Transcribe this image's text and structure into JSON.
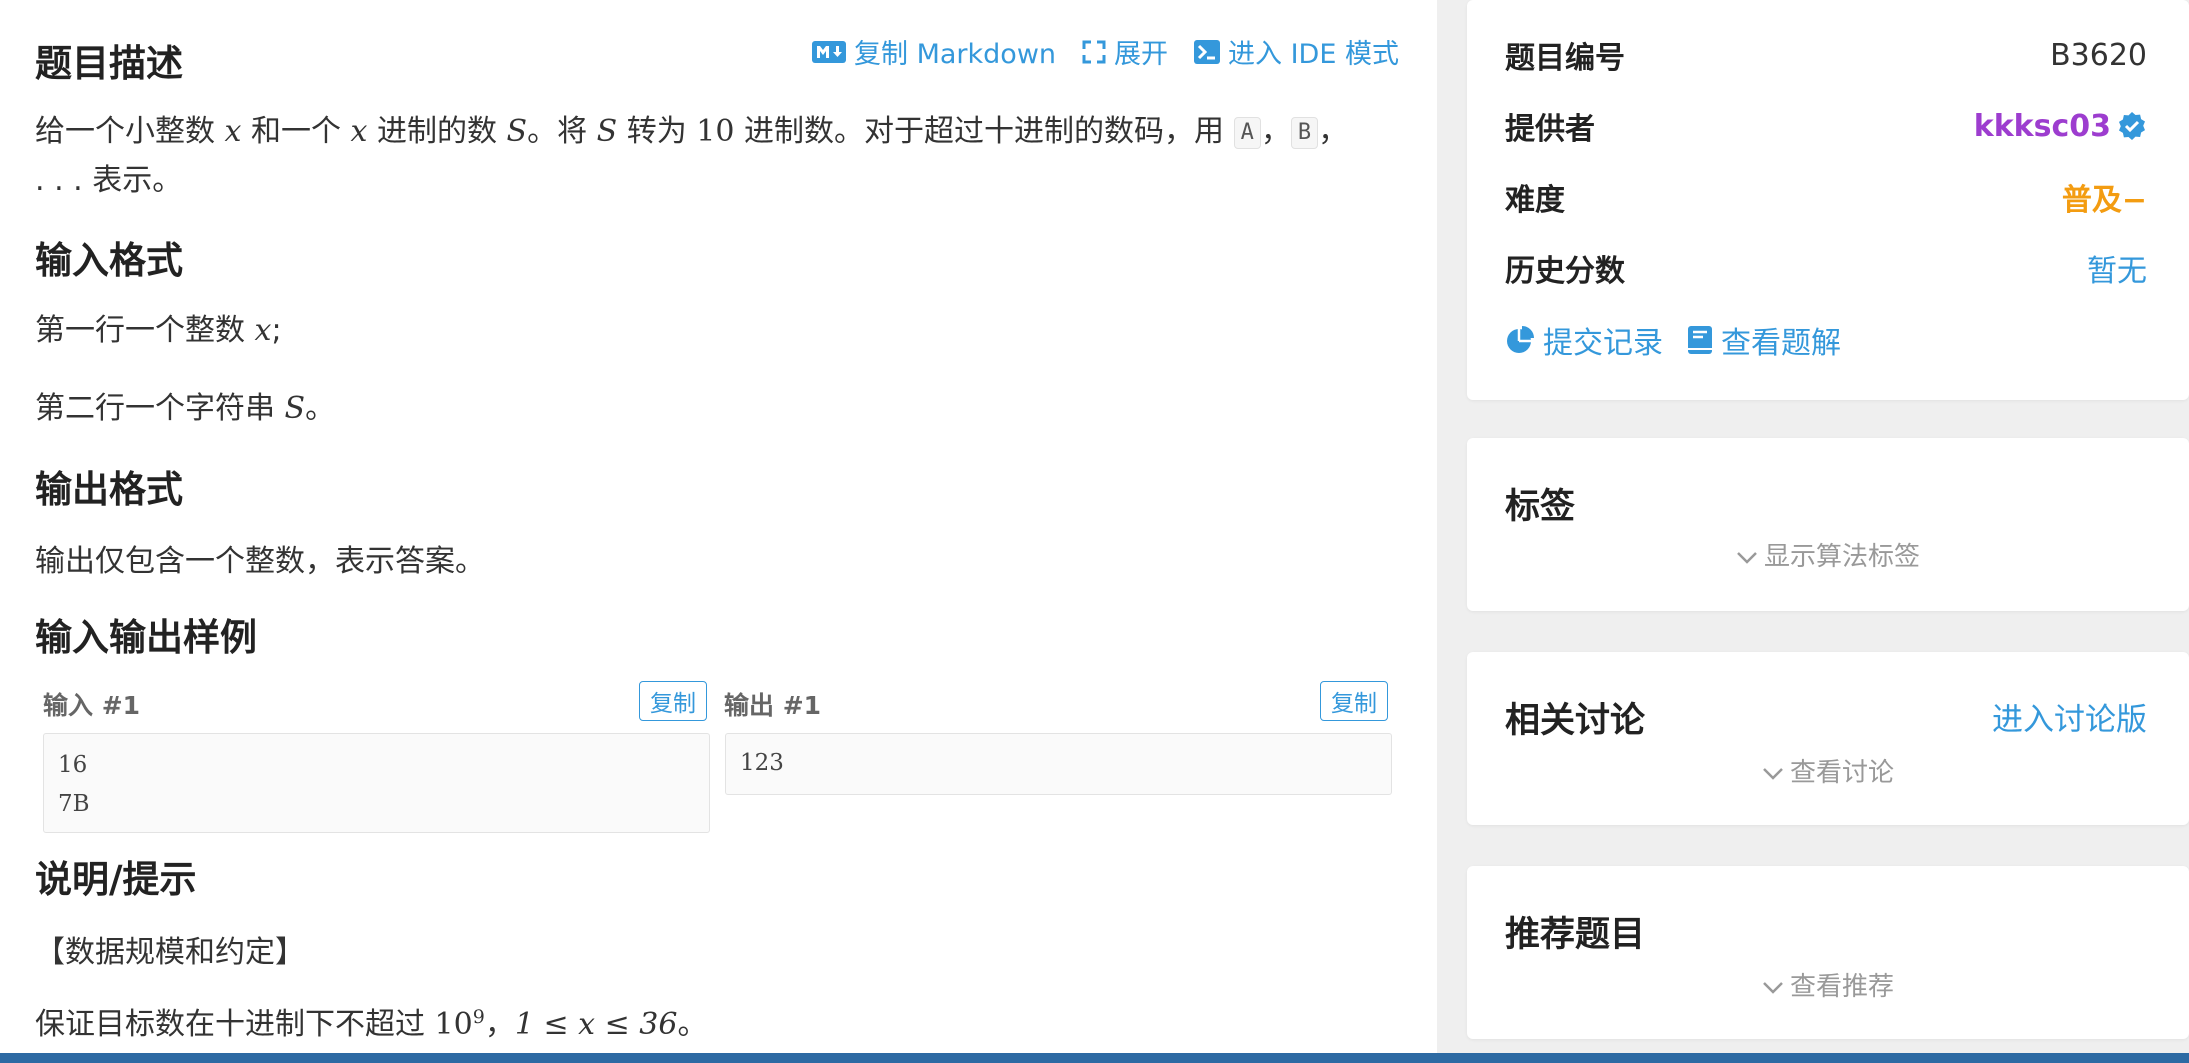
{
  "problem": {
    "desc_title": "题目描述",
    "toolbar": {
      "copy_md": "复制 Markdown",
      "expand": "展开",
      "ide": "进入 IDE 模式"
    },
    "desc": {
      "t1": "给一个小整数 ",
      "x": "x",
      "t2": " 和一个 ",
      "t3": " 进制的数 ",
      "S": "S",
      "t4": "。将 ",
      "t5": " 转为 ",
      "ten": "10",
      "t6": " 进制数。对于超过十进制的数码，用 ",
      "A": "A",
      "comma": "，",
      "B": "B",
      "line2": ". . . 表示。"
    },
    "input_title": "输入格式",
    "input_l1a": "第一行一个整数 ",
    "input_l1b": ";",
    "input_l2a": "第二行一个字符串 ",
    "input_l2b": "。",
    "output_title": "输出格式",
    "output_text": "输出仅包含一个整数，表示答案。",
    "samples_title": "输入输出样例",
    "sample": {
      "input_label": "输入 #1",
      "output_label": "输出 #1",
      "copy": "复制",
      "input_lines": [
        "16",
        "7B"
      ],
      "output_lines": [
        "123"
      ]
    },
    "hint_title": "说明/提示",
    "hint_l1": "【数据规模和约定】",
    "hint_l2a": "保证目标数在十进制下不超过 ",
    "hint_base": "10",
    "hint_exp": "9",
    "hint_l2b": "，",
    "hint_range": "1 ≤ x ≤ 36",
    "hint_l2c": "。"
  },
  "sidebar": {
    "info": {
      "id_key": "题目编号",
      "id_val": "B3620",
      "provider_key": "提供者",
      "provider_val": "kkksc03",
      "difficulty_key": "难度",
      "difficulty_val": "普及−",
      "history_key": "历史分数",
      "history_val": "暂无",
      "submissions": "提交记录",
      "solutions": "查看题解"
    },
    "tags": {
      "title": "标签",
      "show": "显示算法标签"
    },
    "discuss": {
      "title": "相关讨论",
      "enter": "进入讨论版",
      "show": "查看讨论"
    },
    "recommend": {
      "title": "推荐题目",
      "show": "查看推荐"
    }
  },
  "colors": {
    "link": "#3498db",
    "provider": "#9d3dcf",
    "difficulty": "#f39c11",
    "verified": "#3498db"
  }
}
